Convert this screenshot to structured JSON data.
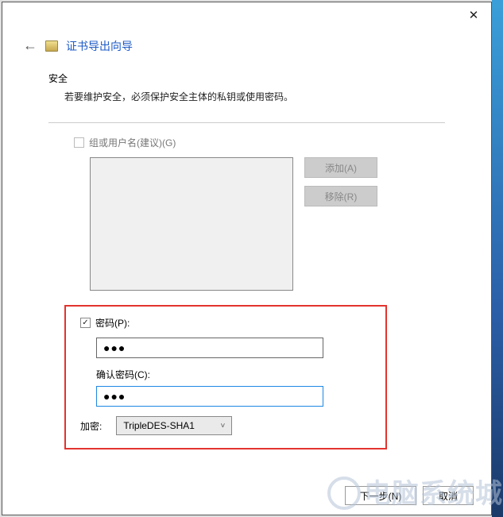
{
  "window": {
    "title": "证书导出向导"
  },
  "section": {
    "heading": "安全",
    "description": "若要维护安全，必须保护安全主体的私钥或使用密码。"
  },
  "group": {
    "label": "组或用户名(建议)(G)",
    "add": "添加(A)",
    "remove": "移除(R)"
  },
  "password": {
    "checkbox_label": "密码(P):",
    "value_masked": "●●●",
    "confirm_label": "确认密码(C):",
    "confirm_value_masked": "●●●"
  },
  "encryption": {
    "label": "加密:",
    "selected": "TripleDES-SHA1"
  },
  "footer": {
    "next": "下一步(N)",
    "cancel": "取消"
  },
  "watermark": "电脑系统城"
}
